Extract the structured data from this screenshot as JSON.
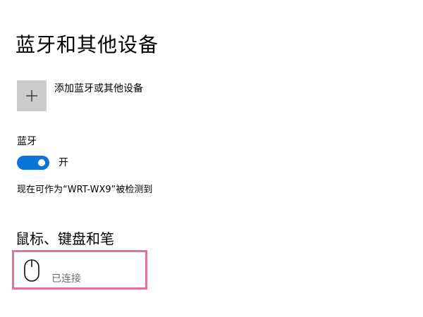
{
  "page": {
    "title": "蓝牙和其他设备"
  },
  "add_device": {
    "label": "添加蓝牙或其他设备",
    "icon": "plus-icon"
  },
  "bluetooth": {
    "label": "蓝牙",
    "toggle_on": true,
    "toggle_state_text": "开",
    "discoverable_text": "现在可作为“WRT-WX9”被检测到",
    "accent_color": "#0a74d8"
  },
  "mouse_keyboard_pen": {
    "heading": "鼠标、键盘和笔",
    "devices": [
      {
        "icon": "mouse-icon",
        "status": "已连接"
      }
    ],
    "highlight_color": "#e4719a"
  }
}
